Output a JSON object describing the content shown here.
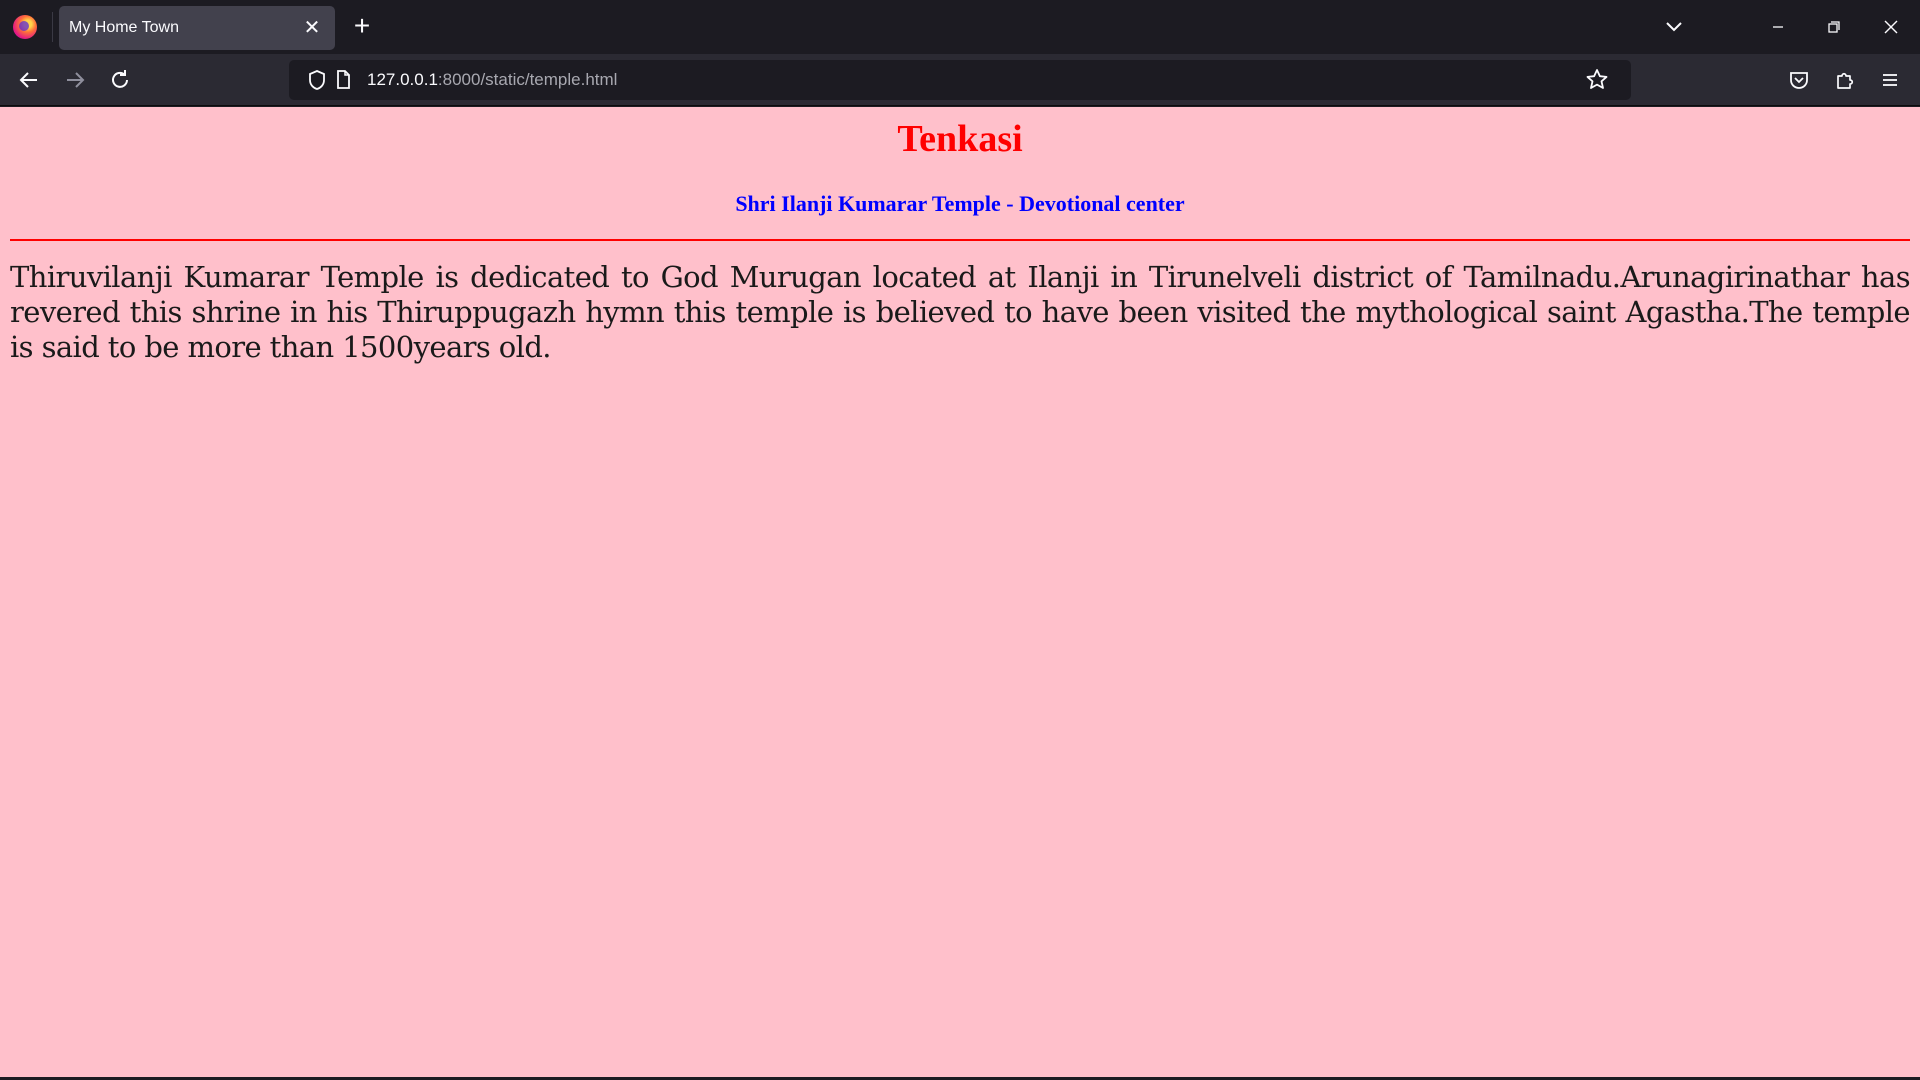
{
  "browser": {
    "tab_title": "My Home Town",
    "tab_close_glyph": "✕",
    "new_tab_glyph": "+",
    "url_host": "127.0.0.1",
    "url_rest": ":8000/static/temple.html",
    "icons": {
      "logo": "firefox-logo-icon",
      "list_all_tabs": "chevron-down-icon",
      "minimize": "minimize-icon",
      "restore": "restore-icon",
      "close": "close-icon",
      "back": "arrow-left-icon",
      "forward": "arrow-right-icon",
      "reload": "reload-icon",
      "tracking_protection": "shield-icon",
      "page_info": "page-icon",
      "bookmark": "star-icon",
      "pocket": "pocket-icon",
      "extensions": "puzzle-icon",
      "menu": "hamburger-menu-icon"
    }
  },
  "page": {
    "background_color": "#ffc0cb",
    "heading": "Tenkasi",
    "heading_color": "#ff0000",
    "subheading": "Shri Ilanji Kumarar Temple - Devotional center",
    "subheading_color": "#0000ff",
    "rule_color": "#ff0000",
    "paragraph": "Thiruvilanji Kumarar Temple is dedicated to God Murugan located at Ilanji in Tirunelveli district of Tamilnadu.Arunagirinathar has revered this shrine in his Thiruppugazh hymn this temple is believed to have been visited the mythological saint Agastha.The temple is said to be more than 1500years old."
  }
}
